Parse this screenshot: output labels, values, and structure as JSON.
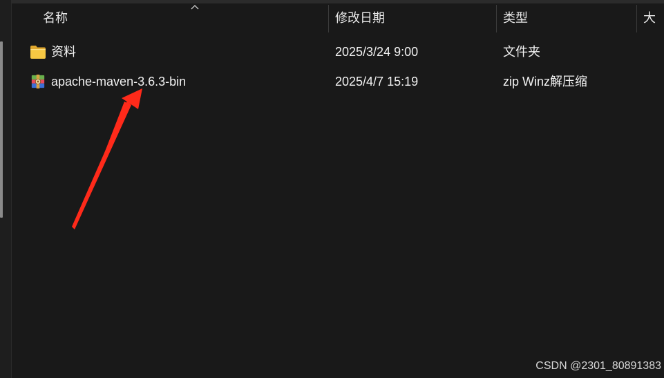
{
  "columns": {
    "name": "名称",
    "date_modified": "修改日期",
    "type": "类型",
    "size": "大小"
  },
  "sort_indicator_icon": "chevron-up-icon",
  "files": [
    {
      "name": "资料",
      "date_modified": "2025/3/24 9:00",
      "type": "文件夹",
      "icon": "folder-icon"
    },
    {
      "name": "apache-maven-3.6.3-bin",
      "date_modified": "2025/4/7 15:19",
      "type": "zip Winz解压缩",
      "icon": "winrar-archive-icon"
    }
  ],
  "annotation": {
    "color": "#ff2a1a",
    "target": "apache-maven-3.6.3-bin"
  },
  "watermark": "CSDN @2301_80891383"
}
